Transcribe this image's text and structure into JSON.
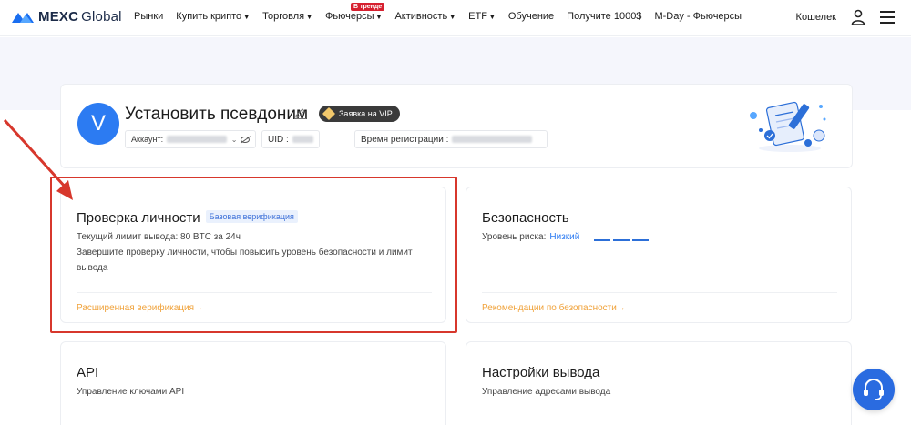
{
  "header": {
    "brand": "MEXC",
    "brand_suffix": "Global",
    "nav": [
      {
        "label": "Рынки",
        "caret": false
      },
      {
        "label": "Купить крипто",
        "caret": true
      },
      {
        "label": "Торговля",
        "caret": true
      },
      {
        "label": "Фьючерсы",
        "caret": true,
        "badge": "В тренде"
      },
      {
        "label": "Активность",
        "caret": true
      },
      {
        "label": "ETF",
        "caret": true
      },
      {
        "label": "Обучение",
        "caret": false
      },
      {
        "label": "Получите 1000$",
        "caret": false
      },
      {
        "label": "M-Day - Фьючерсы",
        "caret": false
      }
    ],
    "wallet": "Кошелек",
    "icons": {
      "user": "user-icon",
      "menu": "hamburger-menu-icon"
    }
  },
  "profile": {
    "avatar_letter": "V",
    "nickname": "Установить псевдоним",
    "vip_label": "Заявка на VIP",
    "account_label": "Аккаунт:",
    "uid_label": "UID :",
    "reg_label": "Время регистрации :"
  },
  "cards": {
    "identity": {
      "title": "Проверка личности",
      "tag": "Базовая верификация",
      "limit": "Текущий лимит вывода: 80 BTC за 24ч",
      "desc": "Завершите проверку личности, чтобы повысить уровень безопасности и лимит вывода",
      "link": "Расширенная верификация→"
    },
    "security": {
      "title": "Безопасность",
      "risk_label": "Уровень риска:",
      "risk_value": "Низкий",
      "link": "Рекомендации по безопасности→"
    },
    "api": {
      "title": "API",
      "desc": "Управление ключами API"
    },
    "withdraw": {
      "title": "Настройки вывода",
      "desc": "Управление адресами вывода"
    }
  },
  "colors": {
    "accent_blue": "#2c7bf2",
    "link_orange": "#f0a23a",
    "highlight_red": "#d7372c"
  }
}
